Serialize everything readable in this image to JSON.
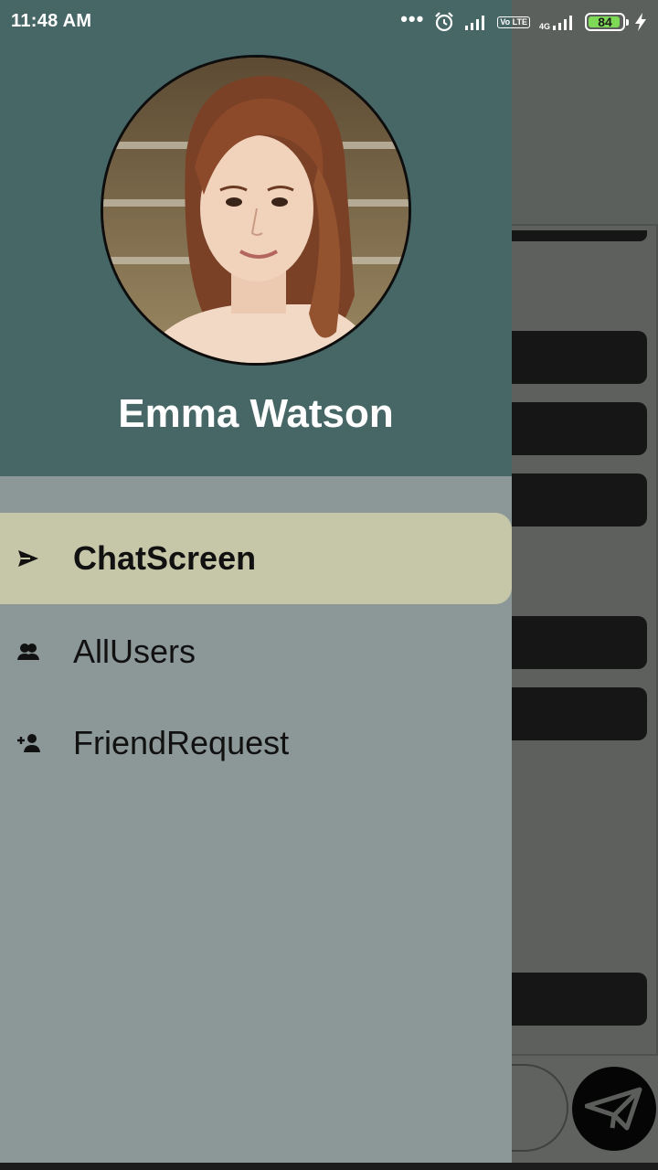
{
  "status_bar": {
    "time": "11:48 AM",
    "battery": "84",
    "network": "4G",
    "volte": "Vo LTE",
    "icons": [
      "more-dots-icon",
      "alarm-icon",
      "signal-icon",
      "volte-icon",
      "signal-4g-icon",
      "battery-icon",
      "charging-icon"
    ]
  },
  "drawer": {
    "profile_name": "Emma Watson",
    "avatar_icon": "profile-photo",
    "items": [
      {
        "label": "ChatScreen",
        "icon": "send-icon",
        "active": true
      },
      {
        "label": "AllUsers",
        "icon": "people-icon",
        "active": false
      },
      {
        "label": "FriendRequest",
        "icon": "person-add-icon",
        "active": false
      }
    ]
  },
  "colors": {
    "drawer_header": "#476766",
    "drawer_body": "#8c9797",
    "active_item": "#c6c7a8",
    "scrim_background": "#5f625f"
  }
}
